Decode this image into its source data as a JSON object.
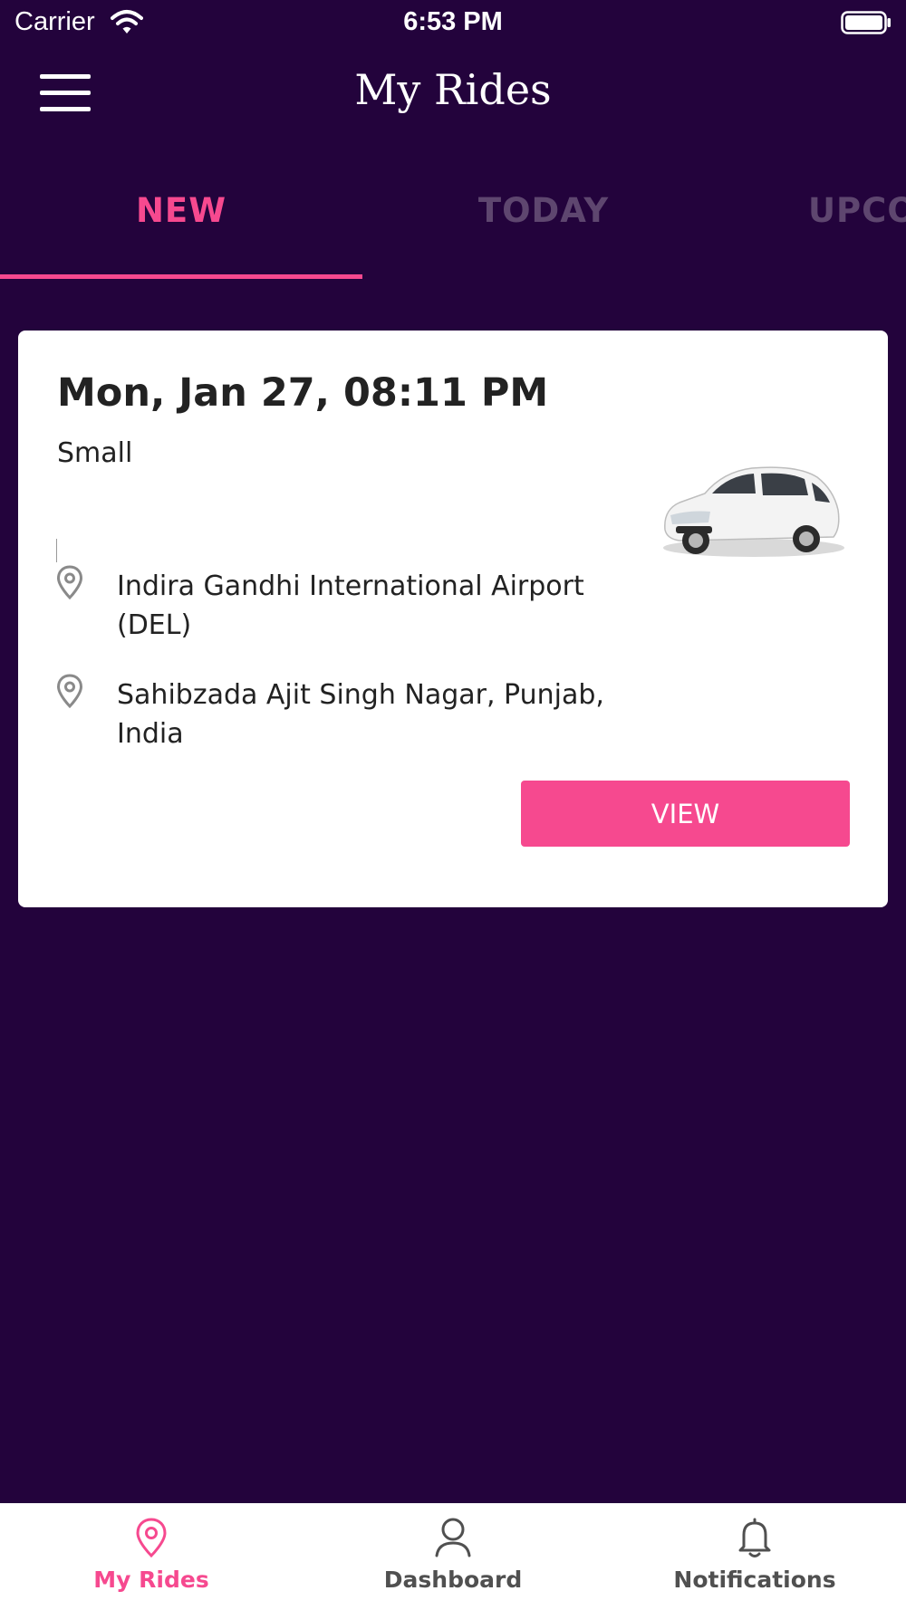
{
  "status_bar": {
    "carrier": "Carrier",
    "time": "6:53 PM"
  },
  "nav": {
    "title": "My Rides",
    "menu_icon": "hamburger-menu-icon"
  },
  "tabs": [
    {
      "label": "NEW",
      "active": true
    },
    {
      "label": "TODAY",
      "active": false
    },
    {
      "label": "UPCO",
      "active": false
    }
  ],
  "ride": {
    "datetime": "Mon, Jan 27, 08:11 PM",
    "vehicle_class": "Small",
    "vehicle_image": "white-hatchback-car",
    "pickup": "Indira Gandhi International Airport (DEL)",
    "dropoff": "Sahibzada Ajit Singh Nagar, Punjab, India",
    "location_icon": "map-pin-icon",
    "view_label": "VIEW"
  },
  "bottom_tabs": [
    {
      "label": "My Rides",
      "icon": "map-pin-icon",
      "active": true
    },
    {
      "label": "Dashboard",
      "icon": "user-icon",
      "active": false
    },
    {
      "label": "Notifications",
      "icon": "bell-icon",
      "active": false
    }
  ],
  "colors": {
    "background": "#23033c",
    "accent": "#f6498f",
    "inactive_tab": "#5e466f",
    "card": "#ffffff"
  }
}
